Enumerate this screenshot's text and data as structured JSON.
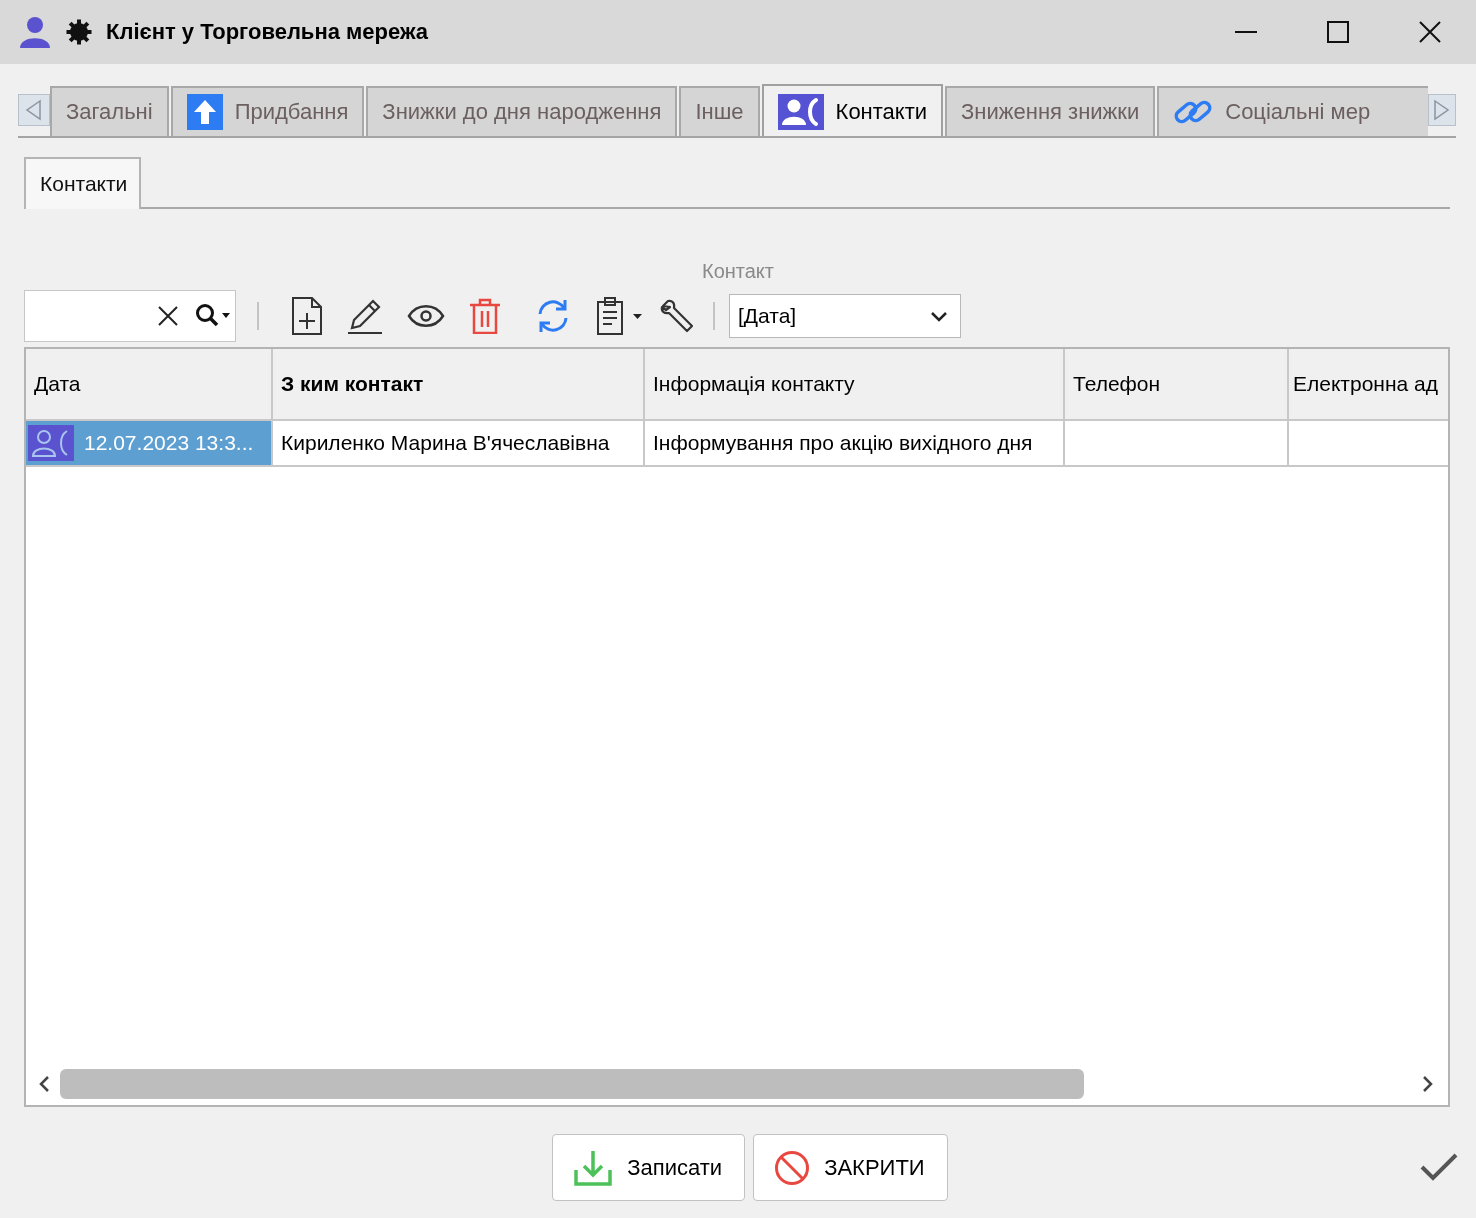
{
  "window": {
    "title": "Клієнт у Торговельна мережа"
  },
  "tabs": [
    {
      "label": "Загальні",
      "kind": "plain",
      "selected": false
    },
    {
      "label": "Придбання",
      "kind": "upload",
      "selected": false
    },
    {
      "label": "Знижки до дня народження",
      "kind": "plain",
      "selected": false
    },
    {
      "label": "Інше",
      "kind": "plain",
      "selected": false
    },
    {
      "label": "Контакти",
      "kind": "contacts",
      "selected": true
    },
    {
      "label": "Зниження знижки",
      "kind": "plain",
      "selected": false
    },
    {
      "label": "Соціальні мер",
      "kind": "link",
      "selected": false
    }
  ],
  "subtabs": [
    {
      "label": "Контакти",
      "selected": true
    }
  ],
  "section": {
    "title": "Контакт"
  },
  "toolbar": {
    "sort_dropdown": {
      "value": "[Дата]"
    }
  },
  "table": {
    "columns": [
      {
        "label": "Дата",
        "primary": false
      },
      {
        "label": "З ким контакт",
        "primary": true
      },
      {
        "label": "Інформація контакту",
        "primary": false
      },
      {
        "label": "Телефон",
        "primary": false
      },
      {
        "label": "Електронна ад",
        "primary": false
      }
    ],
    "rows": [
      {
        "cells": [
          {
            "text": "12.07.2023 13:3...",
            "selected": true
          },
          {
            "text": "Кириленко Марина В'ячеславівна",
            "selected": false
          },
          {
            "text": "Інформування про акцію вихідного дня",
            "selected": false
          },
          {
            "selected": false
          },
          {
            "selected": false
          }
        ]
      }
    ]
  },
  "buttons": [
    {
      "label": "Записати",
      "kind": "save"
    },
    {
      "label": "ЗАКРИТИ",
      "kind": "close"
    }
  ]
}
